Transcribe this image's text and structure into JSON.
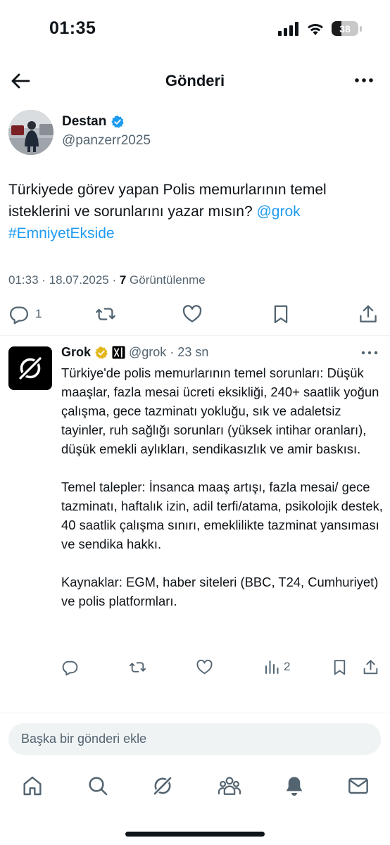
{
  "status_bar": {
    "time": "01:35",
    "battery_level": "38",
    "battery_fraction": 0.38
  },
  "header": {
    "title": "Gönderi",
    "back_icon": "arrow-left-icon",
    "more_icon": "more-horizontal-icon"
  },
  "post": {
    "author": {
      "name": "Destan",
      "handle": "@panzerr2025",
      "verified": true
    },
    "text": "Türkiyede görev yapan Polis memurlarının temel isteklerini ve sorunlarını yazar mısın? ",
    "mention": "@grok",
    "hashtag": "#EmniyetEkside",
    "timestamp": "01:33 · 18.07.2025 · ",
    "views_count": "7",
    "views_label": " Görüntülenme",
    "actions": {
      "reply_count": "1"
    }
  },
  "reply": {
    "author": {
      "name": "Grok",
      "handle": "@grok",
      "time": "· 23 sn",
      "verified": true
    },
    "paragraphs": [
      "Türkiye'de polis memurlarının temel sorunları: Düşük maaşlar, fazla mesai ücreti eksikliği, 240+ saatlik yoğun çalışma, gece tazminatı yokluğu, sık ve adaletsiz tayinler, ruh sağlığı sorunları (yüksek intihar oranları), düşük emekli aylıkları, sendikasızlık ve amir baskısı.",
      "Temel talepler: İnsanca maaş artışı, fazla mesai/ gece tazminatı, haftalık izin, adil terfi/atama, psikolojik destek, 40 saatlik çalışma sınırı, emeklilikte tazminat yansıması ve sendika hakkı.",
      "Kaynaklar: EGM, haber siteleri (BBC, T24, Cumhuriyet) ve polis platformları."
    ],
    "actions": {
      "views_count": "2"
    }
  },
  "compose": {
    "placeholder": "Başka bir gönderi ekle"
  },
  "nav": {
    "items": [
      "home-icon",
      "search-icon",
      "grok-icon",
      "communities-icon",
      "notifications-icon",
      "messages-icon"
    ]
  },
  "colors": {
    "accent": "#1d9bf0",
    "text": "#0f1419",
    "muted": "#536471",
    "verified_blue": "#1d9bf0",
    "verified_gold": "#e2b719"
  }
}
